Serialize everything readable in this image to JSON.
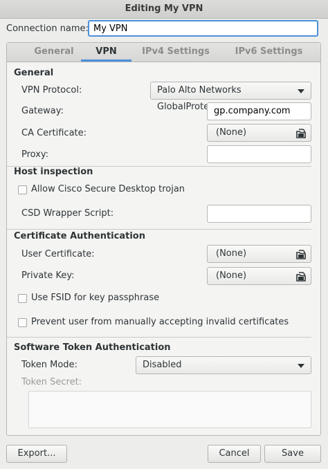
{
  "window": {
    "title": "Editing My VPN"
  },
  "connection": {
    "label": "Connection name:",
    "value": "My VPN"
  },
  "tabs": [
    {
      "label": "General",
      "active": false
    },
    {
      "label": "VPN",
      "active": true
    },
    {
      "label": "IPv4 Settings",
      "active": false
    },
    {
      "label": "IPv6 Settings",
      "active": false
    }
  ],
  "general": {
    "heading": "General",
    "protocol_label": "VPN Protocol:",
    "protocol_value": "Palo Alto Networks GlobalProtect",
    "gateway_label": "Gateway:",
    "gateway_value": "gp.company.com",
    "ca_label": "CA Certificate:",
    "ca_value": "(None)",
    "proxy_label": "Proxy:",
    "proxy_value": ""
  },
  "host_inspection": {
    "heading": "Host inspection",
    "trojan_label": "Allow Cisco Secure Desktop trojan",
    "trojan_checked": false,
    "csd_label": "CSD Wrapper Script:",
    "csd_value": ""
  },
  "cert_auth": {
    "heading": "Certificate Authentication",
    "user_cert_label": "User Certificate:",
    "user_cert_value": "(None)",
    "private_key_label": "Private Key:",
    "private_key_value": "(None)",
    "fsid_label": "Use FSID for key passphrase",
    "fsid_checked": false,
    "prevent_label": "Prevent user from manually accepting invalid certificates",
    "prevent_checked": false
  },
  "token_auth": {
    "heading": "Software Token Authentication",
    "mode_label": "Token Mode:",
    "mode_value": "Disabled",
    "secret_label": "Token Secret:"
  },
  "footer": {
    "export_label": "Export...",
    "cancel_label": "Cancel",
    "save_label": "Save"
  },
  "colors": {
    "accent": "#4a90d9"
  },
  "icons": {
    "file_chooser": "document-open-icon",
    "dropdown": "chevron-down-icon"
  }
}
